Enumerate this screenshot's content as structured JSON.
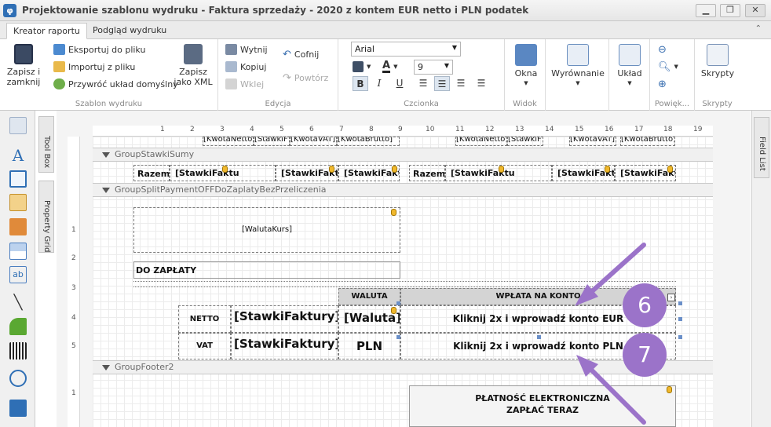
{
  "window": {
    "title": "Projektowanie szablonu wydruku - Faktura sprzedaży - 2020 z kontem EUR netto i PLN podatek",
    "minimize": "▁",
    "maximize": "❐",
    "close": "✕"
  },
  "ribbon_tabs": [
    "Kreator raportu",
    "Podgląd wydruku"
  ],
  "ribbon": {
    "save_close": "Zapisz i zamknij",
    "export_file": "Eksportuj do pliku",
    "import_file": "Importuj z pliku",
    "restore_layout": "Przywróć układ domyślny",
    "save_xml": "Zapisz jako XML",
    "group_template": "Szablon wydruku",
    "cut": "Wytnij",
    "copy": "Kopiuj",
    "paste": "Wklej",
    "undo": "Cofnij",
    "redo": "Powtórz",
    "group_edit": "Edycja",
    "font_name": "Arial",
    "font_size": "9",
    "group_font": "Czcionka",
    "windows": "Okna",
    "group_view": "Widok",
    "align": "Wyrównanie",
    "layout": "Układ",
    "group_zoom": "Powięk...",
    "scripts": "Skrypty",
    "group_scripts": "Skrypty",
    "bold": "B",
    "italic": "I",
    "underline": "U",
    "font_color": "A"
  },
  "side_tabs": {
    "toolbox": "Tool Box",
    "property_grid": "Property Grid",
    "field_list": "Field List"
  },
  "ruler_h": [
    "1",
    "2",
    "3",
    "4",
    "5",
    "6",
    "7",
    "8",
    "9",
    "10",
    "11",
    "12",
    "13",
    "14",
    "15",
    "16",
    "17",
    "18",
    "19"
  ],
  "ruler_v": [
    "1",
    "2",
    "3",
    "4",
    "5",
    "1"
  ],
  "bands": {
    "group_stawki_sumy": "GroupStawkiSumy",
    "group_split": "GroupSplitPaymentOFFDoZaplatyBezPrzeliczenia",
    "group_footer2": "GroupFooter2"
  },
  "top_cells": [
    "[KwotaNetto]",
    "[StawkiF",
    "[KwotaVAT]",
    "[KwotaBrutto]",
    "[KwotaNetto]",
    "[StawkiF",
    "[KwotaVAT]",
    "[KwotaBrutto]"
  ],
  "sum_row": {
    "razem1": "Razem",
    "c1": "[StawkiFaktu",
    "c2": "[StawkiFakt",
    "c3": "[StawkiFakt",
    "razem2": "Razem",
    "c4": "[StawkiFaktu",
    "c5": "[StawkiFakt",
    "c6": "[StawkiFakt"
  },
  "waluta_kurs": "[WalutaKurs]",
  "do_zaplaty": "DO ZAPŁATY",
  "table": {
    "header_waluta": "WALUTA",
    "header_wplata": "WPŁATA NA KONTO",
    "netto": "NETTO",
    "vat": "VAT",
    "stawki1": "[StawkiFaktury].[",
    "stawki2": "[StawkiFaktury].[",
    "waluta_field": "[Waluta]",
    "pln": "PLN",
    "eur_account": "Kliknij 2x i wprowadź konto EUR",
    "pln_account": "Kliknij 2x i wprowadź konto PLN"
  },
  "payment_box": {
    "line1": "PŁATNOŚĆ ELEKTRONICZNA",
    "line2": "ZAPŁAĆ TERAZ"
  },
  "callouts": [
    "6",
    "7"
  ],
  "colors": {
    "accent_purple": "#9b73c9",
    "field_icon": "#f0b82d"
  }
}
